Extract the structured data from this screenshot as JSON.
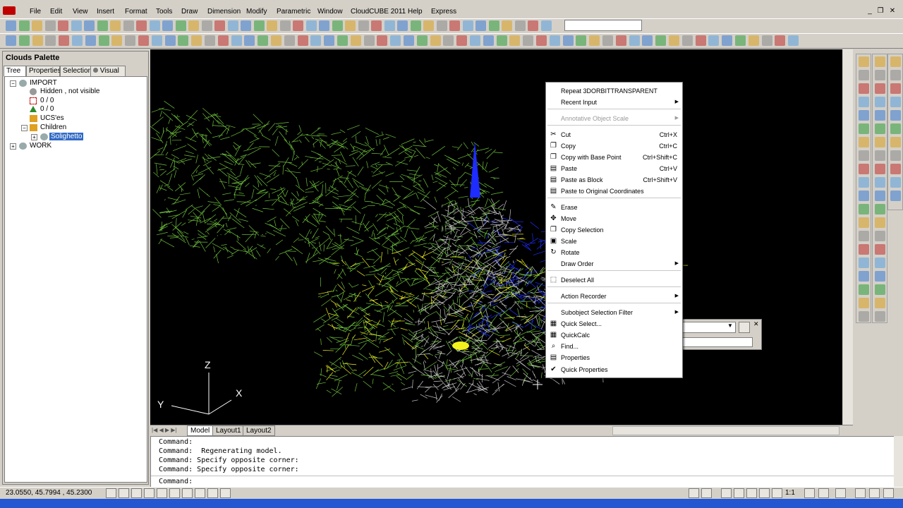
{
  "menubar": {
    "items": [
      "File",
      "Edit",
      "View",
      "Insert",
      "Format",
      "Tools",
      "Draw",
      "Dimension",
      "Modify",
      "Parametric",
      "Window",
      "CloudCUBE 2011",
      "Help",
      "Express"
    ]
  },
  "window_controls": {
    "minimize": "_",
    "restore": "❐",
    "close": "✕"
  },
  "palette": {
    "title": "Clouds Palette",
    "tabs": [
      "Tree",
      "Properties",
      "Selection",
      "Visual"
    ],
    "tree": [
      {
        "label": "IMPORT",
        "icon": "cloud-icon"
      },
      {
        "label": "Hidden , not visible",
        "icon": "circle-icon"
      },
      {
        "label": "0 / 0",
        "icon": "polyline-icon"
      },
      {
        "label": "0 / 0",
        "icon": "triangle-icon"
      },
      {
        "label": "UCS'es",
        "icon": "folder-icon"
      },
      {
        "label": "Children",
        "icon": "folder-icon"
      },
      {
        "label": "Solighetto",
        "icon": "cloud-icon"
      },
      {
        "label": "WORK",
        "icon": "cloud-icon"
      }
    ]
  },
  "viewport": {
    "axis_labels": {
      "z": "Z",
      "y": "Y",
      "x": "X"
    }
  },
  "layout_tabs": [
    "Model",
    "Layout1",
    "Layout2"
  ],
  "context_menu": {
    "items": [
      {
        "label": "Repeat 3DORBITTRANSPARENT",
        "shortcut": "",
        "submenu": false,
        "icon": "",
        "disabled": false
      },
      {
        "label": "Recent Input",
        "shortcut": "",
        "submenu": true,
        "icon": "",
        "disabled": false
      },
      {
        "label": "Annotative Object Scale",
        "shortcut": "",
        "submenu": true,
        "icon": "",
        "disabled": true
      },
      {
        "label": "Cut",
        "shortcut": "Ctrl+X",
        "submenu": false,
        "icon": "✂",
        "disabled": false
      },
      {
        "label": "Copy",
        "shortcut": "Ctrl+C",
        "submenu": false,
        "icon": "❐",
        "disabled": false
      },
      {
        "label": "Copy with Base Point",
        "shortcut": "Ctrl+Shift+C",
        "submenu": false,
        "icon": "❐",
        "disabled": false
      },
      {
        "label": "Paste",
        "shortcut": "Ctrl+V",
        "submenu": false,
        "icon": "▤",
        "disabled": false
      },
      {
        "label": "Paste as Block",
        "shortcut": "Ctrl+Shift+V",
        "submenu": false,
        "icon": "▤",
        "disabled": false
      },
      {
        "label": "Paste to Original Coordinates",
        "shortcut": "",
        "submenu": false,
        "icon": "▤",
        "disabled": false
      },
      {
        "label": "Erase",
        "shortcut": "",
        "submenu": false,
        "icon": "✎",
        "disabled": false
      },
      {
        "label": "Move",
        "shortcut": "",
        "submenu": false,
        "icon": "✥",
        "disabled": false
      },
      {
        "label": "Copy Selection",
        "shortcut": "",
        "submenu": false,
        "icon": "❐",
        "disabled": false
      },
      {
        "label": "Scale",
        "shortcut": "",
        "submenu": false,
        "icon": "▣",
        "disabled": false
      },
      {
        "label": "Rotate",
        "shortcut": "",
        "submenu": false,
        "icon": "↻",
        "disabled": false
      },
      {
        "label": "Draw Order",
        "shortcut": "",
        "submenu": true,
        "icon": "",
        "disabled": false
      },
      {
        "label": "Deselect All",
        "shortcut": "",
        "submenu": false,
        "icon": "⬚",
        "disabled": false
      },
      {
        "label": "Action Recorder",
        "shortcut": "",
        "submenu": true,
        "icon": "",
        "disabled": false
      },
      {
        "label": "Subobject Selection Filter",
        "shortcut": "",
        "submenu": true,
        "icon": "",
        "disabled": false
      },
      {
        "label": "Quick Select...",
        "shortcut": "",
        "submenu": false,
        "icon": "▦",
        "disabled": false
      },
      {
        "label": "QuickCalc",
        "shortcut": "",
        "submenu": false,
        "icon": "▦",
        "disabled": false
      },
      {
        "label": "Find...",
        "shortcut": "",
        "submenu": false,
        "icon": "⌕",
        "disabled": false
      },
      {
        "label": "Properties",
        "shortcut": "",
        "submenu": false,
        "icon": "▤",
        "disabled": false
      },
      {
        "label": "Quick Properties",
        "shortcut": "",
        "submenu": false,
        "icon": "✔",
        "disabled": false
      }
    ]
  },
  "command": {
    "history": [
      "Command:",
      "Command:  Regenerating model.",
      "Command: Specify opposite corner:",
      "Command: Specify opposite corner:"
    ],
    "prompt": "Command:"
  },
  "status": {
    "coordinates": "23.0550, 45.7994 , 45.2300",
    "scale": "1:1"
  },
  "colors": {
    "selection": "#316ac5",
    "viewport_bg": "#000000",
    "mesh_green": "#6ec23a",
    "mesh_yellow": "#f2f21e",
    "mesh_blue": "#1e2cff"
  }
}
